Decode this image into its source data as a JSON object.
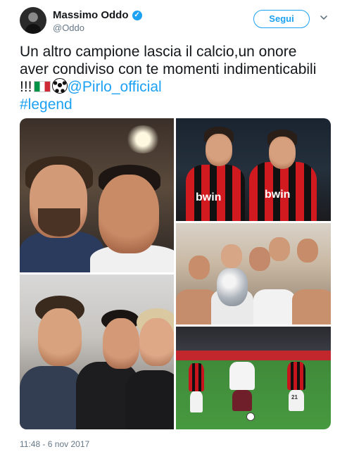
{
  "author": {
    "display_name": "Massimo Oddo",
    "handle": "@Oddo",
    "verified": true,
    "avatar_icon": "profile-photo"
  },
  "actions": {
    "follow_label": "Segui",
    "menu_icon": "chevron-down-icon"
  },
  "tweet": {
    "text_part1": "Un altro campione lascia il calcio,un onore aver condiviso con te momenti indimenticabili !!!",
    "flag_emoji": "🇮🇹",
    "ball_emoji": "⚽",
    "mention": "@Pirlo_official",
    "hashtag": "#legend"
  },
  "media": {
    "photos": [
      {
        "name": "selfie-photo"
      },
      {
        "name": "milan-teammates-photo",
        "sponsor_text": "bwin"
      },
      {
        "name": "trophy-celebration-photo"
      },
      {
        "name": "three-men-photo"
      },
      {
        "name": "match-action-photo",
        "shirt_numbers": [
          "21"
        ]
      }
    ]
  },
  "meta": {
    "timestamp": "11:48 - 6 nov 2017"
  },
  "colors": {
    "accent": "#1da1f2",
    "text": "#14171a",
    "muted": "#657786"
  }
}
